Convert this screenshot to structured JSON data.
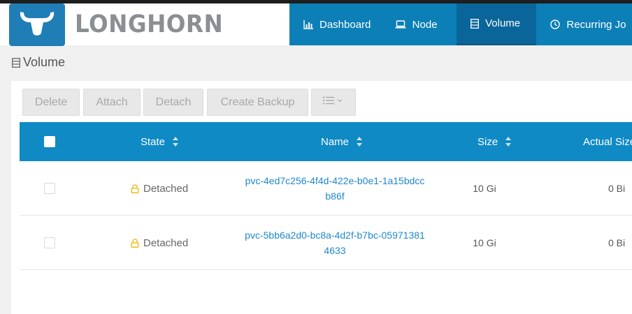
{
  "app": {
    "logo_text": "LONGHORN"
  },
  "nav": {
    "items": [
      {
        "label": "Dashboard",
        "icon": "bar-chart-icon"
      },
      {
        "label": "Node",
        "icon": "laptop-icon"
      },
      {
        "label": "Volume",
        "icon": "volume-list-icon",
        "active": true
      },
      {
        "label": "Recurring Jo",
        "icon": "clock-icon"
      }
    ]
  },
  "page": {
    "title": "Volume"
  },
  "toolbar": {
    "delete_label": "Delete",
    "attach_label": "Attach",
    "detach_label": "Detach",
    "backup_label": "Create Backup",
    "columns_icon": "list-dropdown-icon"
  },
  "table": {
    "columns": [
      "State",
      "Name",
      "Size",
      "Actual Size"
    ],
    "rows": [
      {
        "state": "Detached",
        "name": "pvc-4ed7c256-4f4d-422e-b0e1-1a15bdccb86f",
        "size": "10 Gi",
        "actual_size": "0 Bi"
      },
      {
        "state": "Detached",
        "name": "pvc-5bb6a2d0-bc8a-4d2f-b7bc-059713814633",
        "size": "10 Gi",
        "actual_size": "0 Bi"
      }
    ]
  },
  "colors": {
    "nav_bg": "#0d7fb7",
    "nav_active": "#0a669a",
    "table_header": "#0f8ac5",
    "link": "#1f88cc",
    "lock_icon": "#f0b400",
    "logo_blue": "#1f7eb5"
  }
}
